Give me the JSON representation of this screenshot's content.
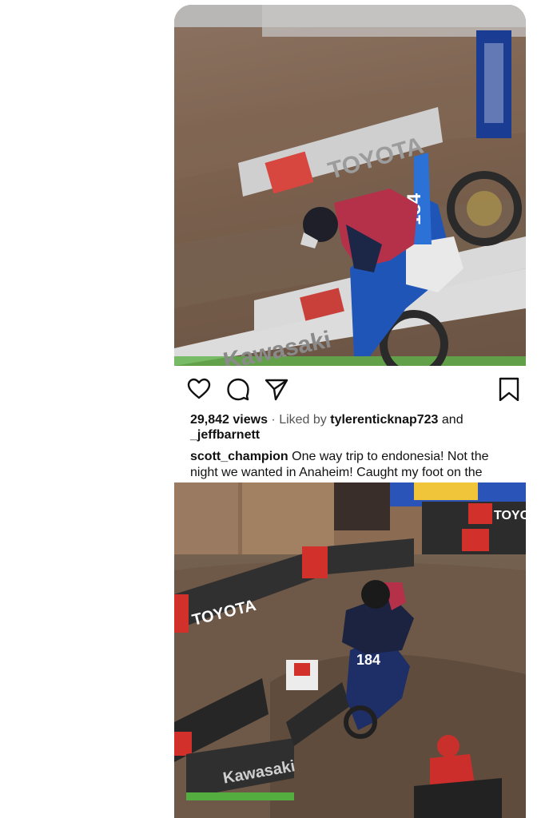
{
  "post": {
    "views_count": "29,842 views",
    "liked_by_prefix": "· Liked by",
    "liked_by_user": "tylerenticknap723",
    "liked_by_and": "and",
    "liked_by_user2": "_jeffbarnett",
    "caption_user": "scott_champion",
    "caption_text": "One way trip to endonesia!  Not the night we wanted in Anaheim!  Caught my foot on the"
  },
  "media": {
    "photo1_brand_text": "TOYOTA",
    "photo1_brand_text2": "Kawasaki",
    "photo1_bike_number": "184",
    "photo2_brand_text": "TOYOTA",
    "photo2_brand_text2": "Kawasaki",
    "photo2_brand_text3": "TOYO",
    "photo2_bike_number": "184"
  },
  "icons": {
    "like": "heart-icon",
    "comment": "comment-icon",
    "share": "send-icon",
    "save": "bookmark-icon"
  }
}
